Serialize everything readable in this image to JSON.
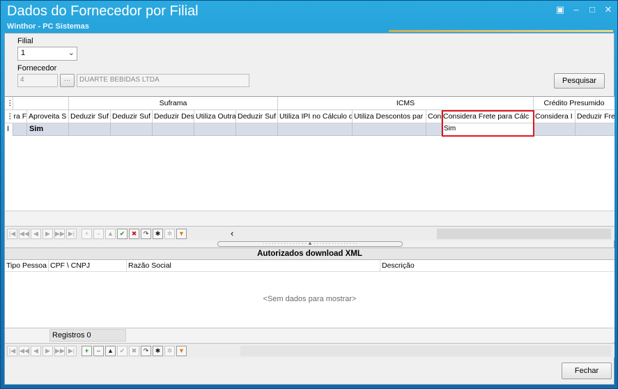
{
  "window": {
    "title": "Dados do Fornecedor por Filial",
    "subtitle": "Winthor - PC Sistemas",
    "controls": [
      "▣",
      "–",
      "□",
      "✕"
    ]
  },
  "filter": {
    "filial_label": "Filial",
    "filial_value": "1",
    "fornecedor_label": "Fornecedor",
    "fornecedor_code": "4",
    "lookup_label": "...",
    "fornecedor_name": "DUARTE BEBIDAS LTDA",
    "pesquisar_label": "Pesquisar"
  },
  "grid1": {
    "bands": [
      "Suframa",
      "ICMS",
      "Crédito Presumido"
    ],
    "columns": [
      "ra F",
      "Aproveita S",
      "Deduzir Suf",
      "Deduzir Suf",
      "Deduzir Des",
      "Utiliza Outra",
      "Deduzir Suf",
      "Utiliza IPI no Cálculo d",
      "Utiliza Descontos par",
      "Con",
      "Considera Frete para Cálc",
      "Considera I",
      "Deduzir Fre"
    ],
    "row": {
      "aproveita": "Sim",
      "considera_frete": "Sim"
    },
    "highlight_color": "#e0141e"
  },
  "nav_icons": [
    "|◀",
    "◀◀",
    "◀",
    "▶",
    "▶▶",
    "▶|",
    "+",
    "–",
    "▲",
    "✔",
    "✖",
    "↷",
    "✱",
    "✲",
    "▼"
  ],
  "scroll_left_glyph": "‹",
  "grid2": {
    "panel_title": "Autorizados download XML",
    "columns": [
      "Tipo Pessoa",
      "CPF \\ CNPJ",
      "Razão Social",
      "Descrição"
    ],
    "empty_text": "<Sem dados para mostrar>",
    "registros_label": "Registros 0"
  },
  "fechar_label": "Fechar"
}
